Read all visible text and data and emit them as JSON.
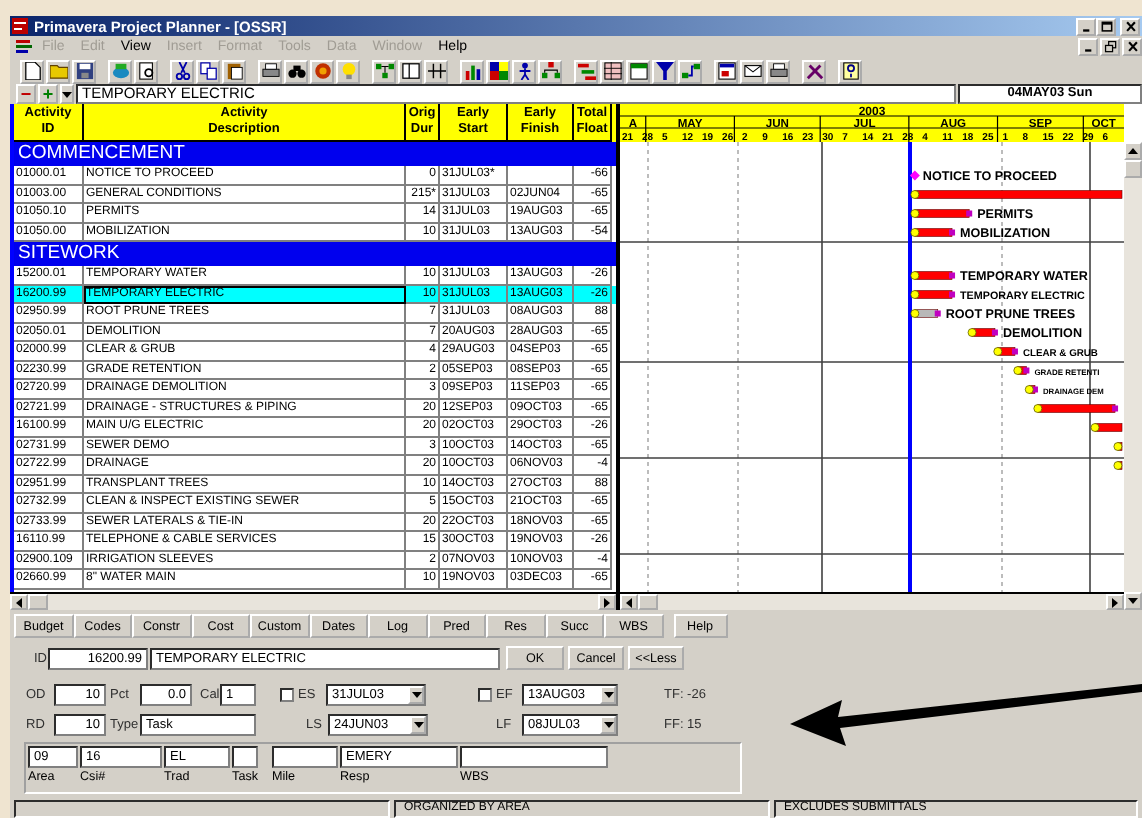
{
  "window": {
    "title": "Primavera Project Planner - [OSSR]"
  },
  "menu": [
    {
      "label": "File",
      "disabled": true
    },
    {
      "label": "Edit",
      "disabled": true
    },
    {
      "label": "View",
      "disabled": false
    },
    {
      "label": "Insert",
      "disabled": true
    },
    {
      "label": "Format",
      "disabled": true
    },
    {
      "label": "Tools",
      "disabled": true
    },
    {
      "label": "Data",
      "disabled": true
    },
    {
      "label": "Window",
      "disabled": true
    },
    {
      "label": "Help",
      "disabled": false
    }
  ],
  "edit_bar": {
    "collapse": "−",
    "expand": "+",
    "value": "TEMPORARY ELECTRIC",
    "date": "04MAY03 Sun"
  },
  "table": {
    "columns": [
      "Activity\nID",
      "Activity\nDescription",
      "Orig\nDur",
      "Early\nStart",
      "Early\nFinish",
      "Total\nFloat"
    ],
    "groups": [
      {
        "title": "COMMENCEMENT",
        "rows": [
          {
            "id": "01000.01",
            "description": "NOTICE TO PROCEED",
            "dur": "0",
            "start": "31JUL03*",
            "float": "-66",
            "selected": false,
            "critical": true,
            "kind": "milestone",
            "bar_label": "NOTICE TO PROCEED"
          },
          {
            "id": "01003.00",
            "description": "GENERAL CONDITIONS",
            "dur": "215*",
            "start": "31JUL03",
            "finish": "02JUN04",
            "float": "-65",
            "selected": false,
            "critical": true,
            "kind": "task"
          },
          {
            "id": "01050.10",
            "description": "PERMITS",
            "dur": "14",
            "start": "31JUL03",
            "finish": "19AUG03",
            "float": "-65",
            "selected": false,
            "critical": true,
            "kind": "task",
            "bar_label": "PERMITS"
          },
          {
            "id": "01050.00",
            "description": "MOBILIZATION",
            "dur": "10",
            "start": "31JUL03",
            "finish": "13AUG03",
            "float": "-54",
            "selected": false,
            "critical": true,
            "kind": "task",
            "bar_label": "MOBILIZATION"
          }
        ]
      },
      {
        "title": "SITEWORK",
        "rows": [
          {
            "id": "15200.01",
            "description": "TEMPORARY WATER",
            "dur": "10",
            "start": "31JUL03",
            "finish": "13AUG03",
            "float": "-26",
            "selected": false,
            "critical": true,
            "kind": "task",
            "bar_label": "TEMPORARY WATER"
          },
          {
            "id": "16200.99",
            "description": "TEMPORARY ELECTRIC",
            "dur": "10",
            "start": "31JUL03",
            "finish": "13AUG03",
            "float": "-26",
            "selected": true,
            "critical": true,
            "kind": "task",
            "bar_label": "TEMPORARY ELECTRIC"
          },
          {
            "id": "02950.99",
            "description": "ROOT PRUNE TREES",
            "dur": "7",
            "start": "31JUL03",
            "finish": "08AUG03",
            "float": "88",
            "selected": false,
            "critical": false,
            "kind": "task",
            "bar_label": "ROOT PRUNE TREES"
          },
          {
            "id": "02050.01",
            "description": "DEMOLITION",
            "dur": "7",
            "start": "20AUG03",
            "finish": "28AUG03",
            "float": "-65",
            "selected": false,
            "critical": true,
            "kind": "task",
            "bar_label": "DEMOLITION"
          },
          {
            "id": "02000.99",
            "description": "CLEAR & GRUB",
            "dur": "4",
            "start": "29AUG03",
            "finish": "04SEP03",
            "float": "-65",
            "selected": false,
            "critical": true,
            "kind": "task",
            "bar_label": "CLEAR & GRUB"
          },
          {
            "id": "02230.99",
            "description": "GRADE RETENTION",
            "dur": "2",
            "start": "05SEP03",
            "finish": "08SEP03",
            "float": "-65",
            "selected": false,
            "critical": true,
            "kind": "task",
            "bar_label": "GRADE RETENTI"
          },
          {
            "id": "02720.99",
            "description": "DRAINAGE DEMOLITION",
            "dur": "3",
            "start": "09SEP03",
            "finish": "11SEP03",
            "float": "-65",
            "selected": false,
            "critical": true,
            "kind": "task",
            "bar_label": "DRAINAGE DEM"
          },
          {
            "id": "02721.99",
            "description": "DRAINAGE - STRUCTURES & PIPING",
            "dur": "20",
            "start": "12SEP03",
            "finish": "09OCT03",
            "float": "-65",
            "selected": false,
            "critical": true,
            "kind": "task"
          },
          {
            "id": "16100.99",
            "description": "MAIN U/G ELECTRIC",
            "dur": "20",
            "start": "02OCT03",
            "finish": "29OCT03",
            "float": "-26",
            "selected": false,
            "critical": true,
            "kind": "task"
          },
          {
            "id": "02731.99",
            "description": "SEWER DEMO",
            "dur": "3",
            "start": "10OCT03",
            "finish": "14OCT03",
            "float": "-65",
            "selected": false,
            "critical": true,
            "kind": "task"
          },
          {
            "id": "02722.99",
            "description": "DRAINAGE",
            "dur": "20",
            "start": "10OCT03",
            "finish": "06NOV03",
            "float": "-4",
            "selected": false,
            "critical": true,
            "kind": "task"
          },
          {
            "id": "02951.99",
            "description": "TRANSPLANT TREES",
            "dur": "10",
            "start": "14OCT03",
            "finish": "27OCT03",
            "float": "88",
            "selected": false
          },
          {
            "id": "02732.99",
            "description": "CLEAN & INSPECT EXISTING SEWER",
            "dur": "5",
            "start": "15OCT03",
            "finish": "21OCT03",
            "float": "-65",
            "selected": false
          },
          {
            "id": "02733.99",
            "description": "SEWER LATERALS & TIE-IN",
            "dur": "20",
            "start": "22OCT03",
            "finish": "18NOV03",
            "float": "-65",
            "selected": false
          },
          {
            "id": "16110.99",
            "description": "TELEPHONE & CABLE SERVICES",
            "dur": "15",
            "start": "30OCT03",
            "finish": "19NOV03",
            "float": "-26",
            "selected": false
          },
          {
            "id": "02900.109",
            "description": "IRRIGATION SLEEVES",
            "dur": "2",
            "start": "07NOV03",
            "finish": "10NOV03",
            "float": "-4",
            "selected": false
          },
          {
            "id": "02660.99",
            "description": "8\" WATER MAIN",
            "dur": "10",
            "start": "19NOV03",
            "finish": "03DEC03",
            "float": "-65",
            "selected": false
          }
        ]
      }
    ]
  },
  "gantt": {
    "year": "2003",
    "months": [
      "A",
      "MAY",
      "JUN",
      "JUL",
      "AUG",
      "SEP",
      "OCT"
    ],
    "days": [
      "21",
      "28",
      "5",
      "12",
      "19",
      "26",
      "2",
      "9",
      "16",
      "23",
      "30",
      "7",
      "14",
      "21",
      "28",
      "4",
      "11",
      "18",
      "25",
      "1",
      "8",
      "15",
      "22",
      "29",
      "6"
    ]
  },
  "detail_buttons": [
    "Budget",
    "Codes",
    "Constr",
    "Cost",
    "Custom",
    "Dates",
    "Log",
    "Pred",
    "Res",
    "Succ",
    "WBS"
  ],
  "help_button": "Help",
  "form": {
    "id_label": "ID",
    "id": "16200.99",
    "description": "TEMPORARY ELECTRIC",
    "buttons": [
      "OK",
      "Cancel",
      "<<Less"
    ],
    "od": {
      "label": "OD",
      "value": "10"
    },
    "pct": {
      "label": "Pct",
      "value": "0.0"
    },
    "cal": {
      "label": "Cal",
      "value": "1"
    },
    "es": {
      "label": "ES",
      "value": "31JUL03",
      "checked": false
    },
    "ef": {
      "label": "EF",
      "value": "13AUG03",
      "checked": false
    },
    "rd": {
      "label": "RD",
      "value": "10"
    },
    "type": {
      "label": "Type",
      "value": "Task"
    },
    "ls": {
      "label": "LS",
      "value": "24JUN03"
    },
    "lf": {
      "label": "LF",
      "value": "08JUL03"
    },
    "tf": "TF: -26",
    "ff": "FF: 15",
    "codes": [
      {
        "label": "Area",
        "value": "09"
      },
      {
        "label": "Csi#",
        "value": "16"
      },
      {
        "label": "Trad",
        "value": "EL"
      },
      {
        "label": "Task"
      },
      {
        "label": "Mile"
      },
      {
        "label": "Resp",
        "value": "EMERY"
      },
      {
        "label": "WBS"
      }
    ]
  },
  "status_bar": [
    "ORGANIZED BY AREA",
    "EXCLUDES SUBMITTALS"
  ]
}
